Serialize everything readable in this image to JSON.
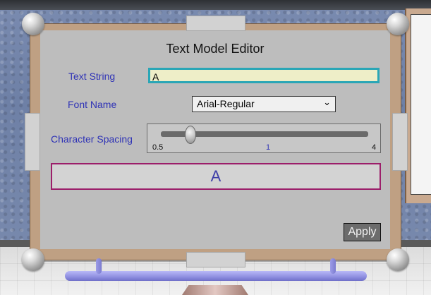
{
  "editor": {
    "title": "Text Model Editor",
    "text_string_label": "Text String",
    "text_string_value": "A",
    "font_name_label": "Font Name",
    "font_name_value": "Arial-Regular",
    "character_spacing_label": "Character Spacing",
    "spacing_min": "0.5",
    "spacing_current": "1",
    "spacing_max": "4",
    "spacing_level_fraction": 0.14,
    "preview_text": "A",
    "apply_label": "Apply"
  },
  "icons": {
    "dropdown": "chevron-down-icon"
  },
  "colors": {
    "panel": "#bdbdbd",
    "frame": "#bfa083",
    "label_text": "#2f33b6",
    "input_border": "#2aa6b6",
    "input_bg": "#eeeec8",
    "preview_border": "#9c1e6a",
    "preview_text": "#3e3ea8",
    "apply_bg": "#6c6c6c"
  }
}
